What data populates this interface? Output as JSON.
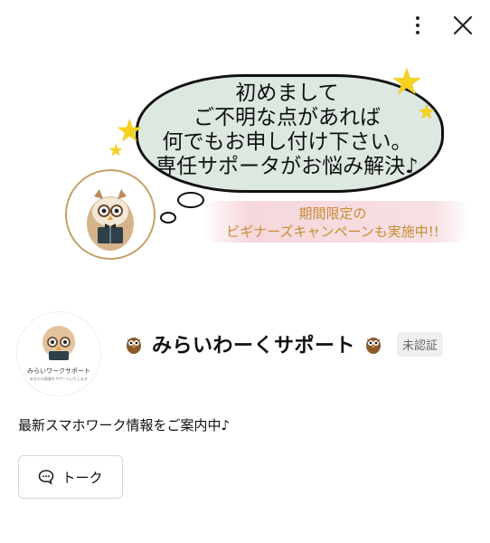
{
  "header": {
    "menu_icon": "more-vertical-icon",
    "close_icon": "close-icon"
  },
  "cover": {
    "bubble_lines": [
      "初めまして",
      "ご不明な点があれば",
      "何でもお申し付け下さい。",
      "専任サポータがお悩み解決♪"
    ],
    "promo_lines": [
      "期間限定の",
      "ビギナーズキャンペーンも実施中!!"
    ]
  },
  "profile": {
    "avatar_caption": "みらいワークサポート",
    "avatar_subcaption": "あなたの副業をサポートいたします",
    "name": "みらいわーくサポート",
    "badge": "未認証",
    "description": "最新スマホワーク情報をご案内中♪"
  },
  "actions": {
    "talk_label": "トーク",
    "talk_icon": "chat-bubble-icon"
  },
  "colors": {
    "bubble_fill": "#dde8e1",
    "promo_text": "#c68d33",
    "star": "#f5d21f",
    "badge_bg": "#efefef"
  }
}
